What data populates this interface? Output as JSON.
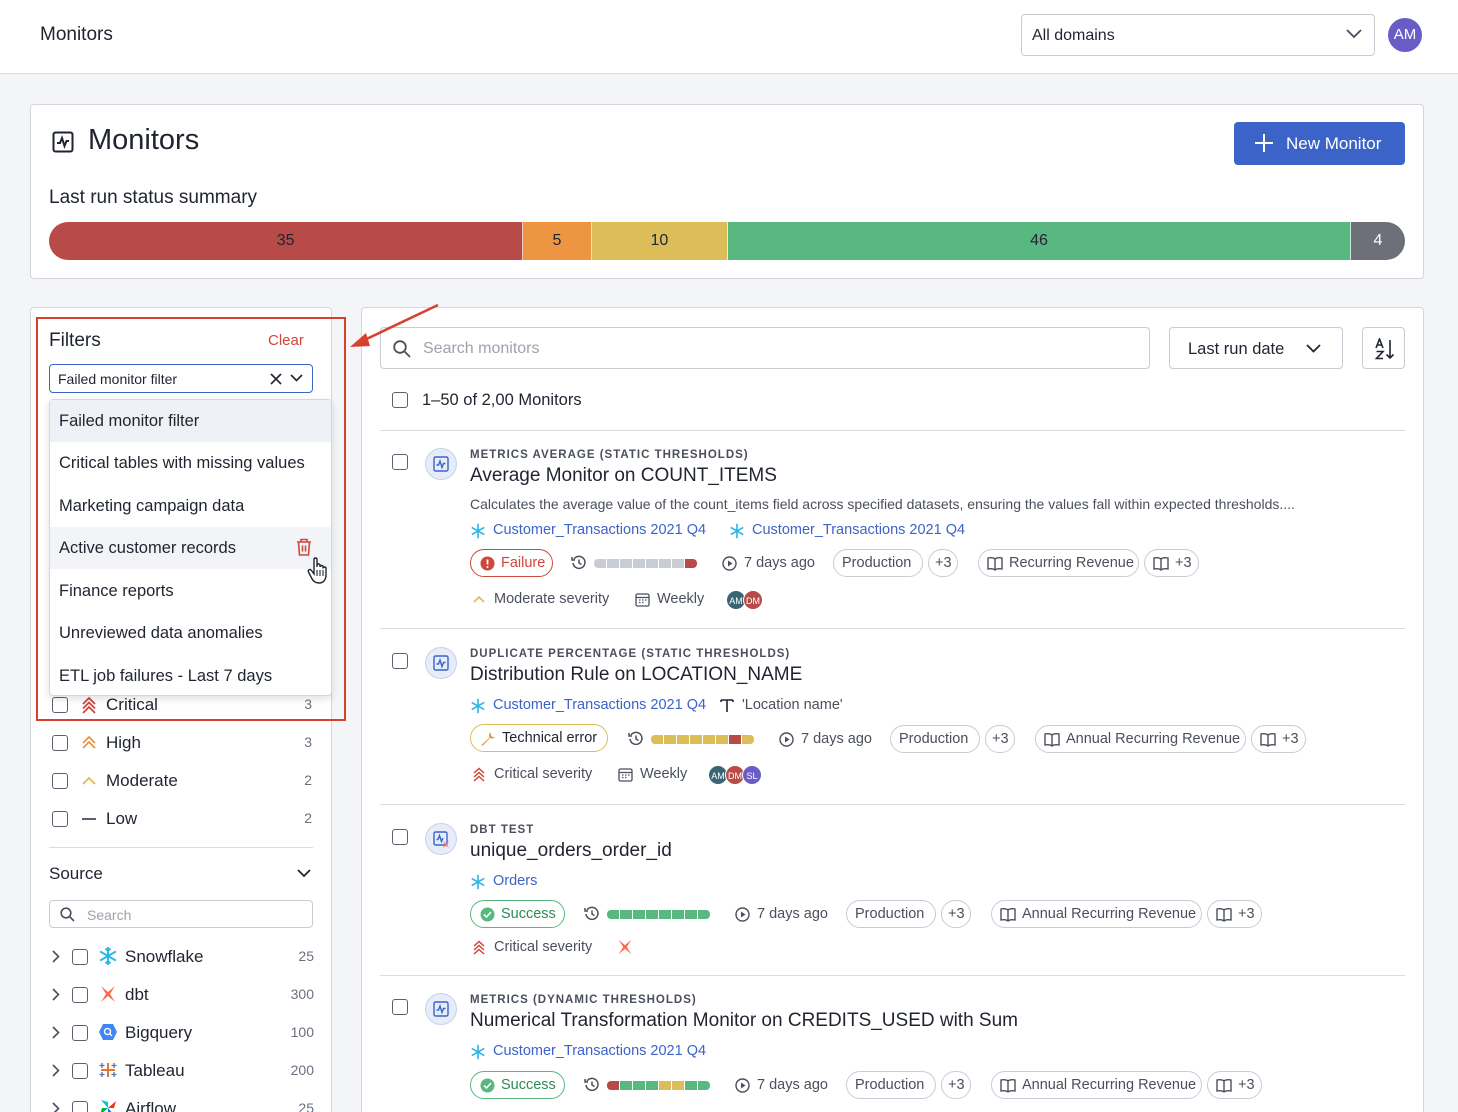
{
  "topbar": {
    "title": "Monitors",
    "domain_select": "All domains",
    "avatar": "AM"
  },
  "header": {
    "title": "Monitors",
    "new_button": "New Monitor",
    "summary_title": "Last run status summary"
  },
  "status_summary": [
    {
      "label": "35",
      "value": 35,
      "color": "#b84a47"
    },
    {
      "label": "5",
      "value": 5,
      "color": "#ee9541"
    },
    {
      "label": "10",
      "value": 10,
      "color": "#dcbd58"
    },
    {
      "label": "46",
      "value": 46,
      "color": "#58b87f"
    },
    {
      "label": "4",
      "value": 4,
      "color": "#6d7079"
    }
  ],
  "filters": {
    "title": "Filters",
    "clear": "Clear",
    "selected_filter": "Failed monitor filter",
    "saved_filters": [
      "Failed monitor filter",
      "Critical tables with missing values",
      "Marketing campaign data",
      "Active customer records",
      "Finance reports",
      "Unreviewed data anomalies",
      "ETL job failures - Last 7 days"
    ],
    "severity": [
      {
        "label": "Critical",
        "count": "3",
        "icon": "critical-severity-icon"
      },
      {
        "label": "High",
        "count": "3",
        "icon": "high-severity-icon"
      },
      {
        "label": "Moderate",
        "count": "2",
        "icon": "moderate-severity-icon"
      },
      {
        "label": "Low",
        "count": "2",
        "icon": "low-severity-icon"
      }
    ],
    "source_title": "Source",
    "source_search_placeholder": "Search",
    "sources": [
      {
        "label": "Snowflake",
        "count": "25",
        "icon": "snowflake-icon"
      },
      {
        "label": "dbt",
        "count": "300",
        "icon": "dbt-icon"
      },
      {
        "label": "Bigquery",
        "count": "100",
        "icon": "bigquery-icon"
      },
      {
        "label": "Tableau",
        "count": "200",
        "icon": "tableau-icon"
      },
      {
        "label": "Airflow",
        "count": "25",
        "icon": "airflow-icon"
      }
    ]
  },
  "list": {
    "search_placeholder": "Search monitors",
    "sort_label": "Last run date",
    "count_text": "1–50 of 2,00 Monitors",
    "monitors": [
      {
        "type": "METRICS AVERAGE (STATIC THRESHOLDS)",
        "name": "Average Monitor on COUNT_ITEMS",
        "description": "Calculates the average value of the count_items field across specified datasets, ensuring the values fall within expected thresholds....",
        "tables": [
          "Customer_Transactions 2021 Q4",
          "Customer_Transactions 2021 Q4"
        ],
        "status": "Failure",
        "last_run": "7 days ago",
        "env": "Production",
        "env_more": "+3",
        "domain": "Recurring Revenue",
        "domain_more": "+3",
        "severity": "Moderate severity",
        "schedule": "Weekly",
        "owners": [
          "AM",
          "DM"
        ]
      },
      {
        "type": "DUPLICATE PERCENTAGE (STATIC THRESHOLDS)",
        "name": "Distribution Rule on LOCATION_NAME",
        "tables": [
          "Customer_Transactions 2021 Q4"
        ],
        "column": "'Location name'",
        "status": "Technical error",
        "last_run": "7 days ago",
        "env": "Production",
        "env_more": "+3",
        "domain": "Annual Recurring Revenue",
        "domain_more": "+3",
        "severity": "Critical severity",
        "schedule": "Weekly",
        "owners": [
          "AM",
          "DM",
          "SL"
        ]
      },
      {
        "type": "DBT TEST",
        "name": "unique_orders_order_id",
        "tables": [
          "Orders"
        ],
        "status": "Success",
        "last_run": "7 days ago",
        "env": "Production",
        "env_more": "+3",
        "domain": "Annual Recurring Revenue",
        "domain_more": "+3",
        "severity": "Critical severity"
      },
      {
        "type": "METRICS (DYNAMIC THRESHOLDS)",
        "name": "Numerical Transformation Monitor on CREDITS_USED with Sum",
        "tables": [
          "Customer_Transactions 2021 Q4"
        ],
        "status": "Success",
        "last_run": "7 days ago",
        "env": "Production",
        "env_more": "+3",
        "domain": "Annual Recurring Revenue",
        "domain_more": "+3"
      }
    ]
  },
  "colors": {
    "accent": "#3b63c8",
    "failure": "#d0463a",
    "warning": "#dcbd58",
    "success": "#58b87f",
    "annotation": "#d9412f"
  }
}
